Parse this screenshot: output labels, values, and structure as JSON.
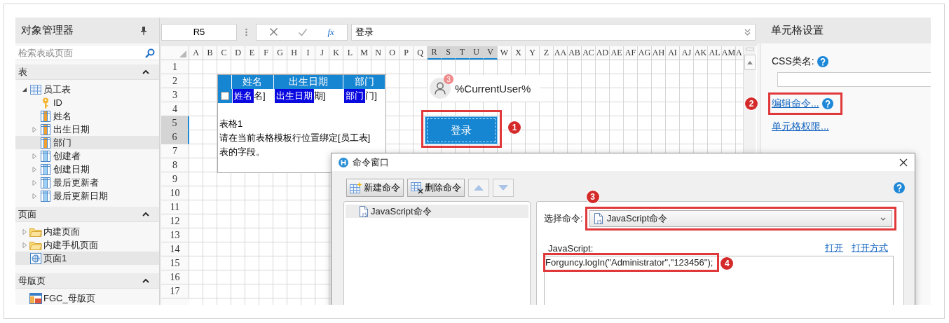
{
  "left_panel": {
    "title": "对象管理器",
    "search": {
      "placeholder": "检索表或页面"
    },
    "sections": [
      {
        "title": "表",
        "expanded": true,
        "items": [
          {
            "label": "员工表",
            "kind": "table",
            "expanded": true,
            "selected": false,
            "children": [
              {
                "label": "ID",
                "kind": "key",
                "selected": false
              },
              {
                "label": "姓名",
                "kind": "field",
                "selected": false
              },
              {
                "label": "出生日期",
                "kind": "field",
                "expanded": false,
                "selected": false
              },
              {
                "label": "部门",
                "kind": "field",
                "selected": true
              },
              {
                "label": "创建者",
                "kind": "system_field",
                "expanded": false,
                "selected": false
              },
              {
                "label": "创建日期",
                "kind": "system_field",
                "expanded": false,
                "selected": false
              },
              {
                "label": "最后更新者",
                "kind": "system_field",
                "expanded": false,
                "selected": false
              },
              {
                "label": "最后更新日期",
                "kind": "system_field",
                "expanded": false,
                "selected": false
              }
            ]
          }
        ]
      },
      {
        "title": "页面",
        "expanded": true,
        "items": [
          {
            "label": "内建页面",
            "kind": "folder",
            "expanded": false,
            "selected": false
          },
          {
            "label": "内建手机页面",
            "kind": "folder",
            "expanded": false,
            "selected": false
          },
          {
            "label": "页面1",
            "kind": "page",
            "selected": true
          }
        ]
      },
      {
        "title": "母版页",
        "expanded": true,
        "items": [
          {
            "label": "FGC_母版页",
            "kind": "master_page",
            "selected": false
          }
        ]
      }
    ]
  },
  "formula_bar": {
    "cell_name": "R5",
    "function_label": "fx",
    "value": "登录"
  },
  "sheet": {
    "columns": [
      {
        "label": "A",
        "selected": false
      },
      {
        "label": "B",
        "selected": false
      },
      {
        "label": "C",
        "selected": false
      },
      {
        "label": "D",
        "selected": false
      },
      {
        "label": "E",
        "selected": false
      },
      {
        "label": "F",
        "selected": false
      },
      {
        "label": "G",
        "selected": false
      },
      {
        "label": "H",
        "selected": false
      },
      {
        "label": "I",
        "selected": false
      },
      {
        "label": "J",
        "selected": false
      },
      {
        "label": "K",
        "selected": false
      },
      {
        "label": "L",
        "selected": false
      },
      {
        "label": "M",
        "selected": false
      },
      {
        "label": "N",
        "selected": false
      },
      {
        "label": "O",
        "selected": false
      },
      {
        "label": "P",
        "selected": false
      },
      {
        "label": "Q",
        "selected": false
      },
      {
        "label": "R",
        "selected": true
      },
      {
        "label": "S",
        "selected": true
      },
      {
        "label": "T",
        "selected": true
      },
      {
        "label": "U",
        "selected": true
      },
      {
        "label": "V",
        "selected": true
      },
      {
        "label": "W",
        "selected": false
      },
      {
        "label": "X",
        "selected": false
      },
      {
        "label": "Y",
        "selected": false
      },
      {
        "label": "Z",
        "selected": false
      },
      {
        "label": "AA",
        "selected": false
      },
      {
        "label": "AB",
        "selected": false
      },
      {
        "label": "AC",
        "selected": false
      },
      {
        "label": "AD",
        "selected": false
      },
      {
        "label": "AE",
        "selected": false
      },
      {
        "label": "AF",
        "selected": false
      },
      {
        "label": "AG",
        "selected": false
      },
      {
        "label": "AH",
        "selected": false
      },
      {
        "label": "AI",
        "selected": false
      },
      {
        "label": "AJ",
        "selected": false
      },
      {
        "label": "AK",
        "selected": false
      },
      {
        "label": "AL",
        "selected": false
      },
      {
        "label": "AM",
        "selected": false
      },
      {
        "label": "A",
        "selected": false
      }
    ],
    "rows": [
      {
        "label": "1",
        "selected": false
      },
      {
        "label": "2",
        "selected": false
      },
      {
        "label": "3",
        "selected": false
      },
      {
        "label": "4",
        "selected": false
      },
      {
        "label": "5",
        "selected": true
      },
      {
        "label": "6",
        "selected": true
      },
      {
        "label": "7",
        "selected": false
      },
      {
        "label": "8",
        "selected": false
      },
      {
        "label": "9",
        "selected": false
      },
      {
        "label": "10",
        "selected": false
      },
      {
        "label": "11",
        "selected": false
      },
      {
        "label": "12",
        "selected": false
      },
      {
        "label": "13",
        "selected": false
      },
      {
        "label": "14",
        "selected": false
      },
      {
        "label": "15",
        "selected": false
      },
      {
        "label": "16",
        "selected": false
      },
      {
        "label": "17",
        "selected": false
      }
    ],
    "table": {
      "checked": false,
      "columns": [
        {
          "header": "姓名",
          "binding": "姓名",
          "binding_tail": "名]"
        },
        {
          "header": "出生日期",
          "binding": "出生日期",
          "binding_tail": "期]"
        },
        {
          "header": "部门",
          "binding": "部门",
          "binding_tail": "门]"
        }
      ],
      "note": [
        "表格1",
        "请在当前表格模板行位置绑定[员工表]",
        "表的字段。"
      ]
    },
    "user_widget": {
      "name": "%CurrentUser%",
      "badge": "3"
    },
    "login_button": {
      "label": "登录",
      "highlighted": true,
      "callout": "1"
    }
  },
  "right_panel": {
    "title": "单元格设置",
    "css_class": {
      "label": "CSS类名:"
    },
    "edit_command": {
      "label": "编辑命令...",
      "highlighted": true,
      "callout": "2"
    },
    "cell_permission": {
      "label": "单元格权限..."
    }
  },
  "dialog": {
    "title": "命令窗口",
    "toolbar": [
      {
        "kind": "new",
        "label": "新建命令",
        "disabled": false
      },
      {
        "kind": "delete",
        "label": "删除命令",
        "disabled": false
      },
      {
        "kind": "up",
        "disabled": true
      },
      {
        "kind": "down",
        "disabled": true
      }
    ],
    "commands": [
      {
        "label": "JavaScript命令",
        "selected": true
      }
    ],
    "command_select": {
      "label": "选择命令:",
      "value": "JavaScript命令",
      "highlighted": true,
      "callout": "3"
    },
    "script": {
      "label": "JavaScript:",
      "links": [
        "打开",
        "打开方式"
      ],
      "code": "Forguncy.logIn(\"Administrator\",\"123456\");",
      "highlighted": true,
      "callout": "4"
    }
  }
}
